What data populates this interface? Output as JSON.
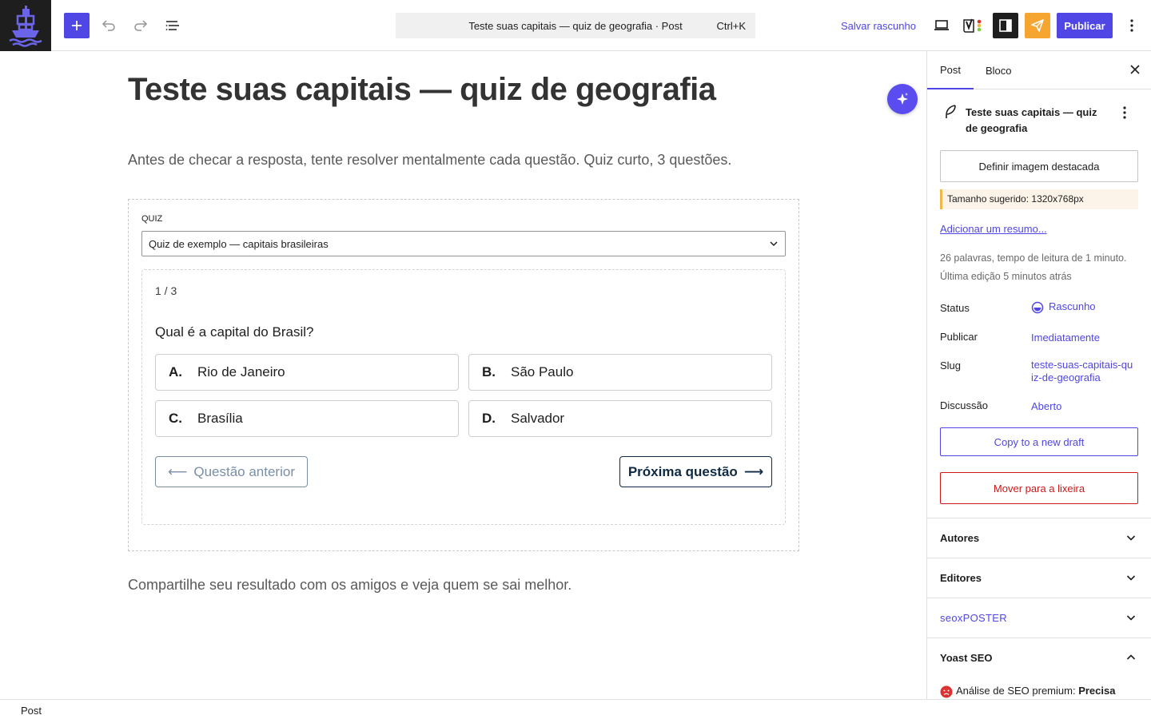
{
  "topbar": {
    "command_title": "Teste suas capitais — quiz de geografia · Post",
    "command_shortcut": "Ctrl+K",
    "save_draft": "Salvar rascunho",
    "publish": "Publicar",
    "accent_color": "#4f46e5"
  },
  "post": {
    "title": "Teste suas capitais — quiz de geografia",
    "intro": "Antes de checar a resposta, tente resolver mentalmente cada questão. Quiz curto, 3 questões.",
    "outro": "Compartilhe seu resultado com os amigos e veja quem se sai melhor."
  },
  "quiz": {
    "label": "QUIZ",
    "selected": "Quiz de exemplo — capitais brasileiras",
    "counter": "1 / 3",
    "question": "Qual é a capital do Brasil?",
    "options": [
      {
        "letter": "A.",
        "text": "Rio de Janeiro"
      },
      {
        "letter": "B.",
        "text": "São Paulo"
      },
      {
        "letter": "C.",
        "text": "Brasília"
      },
      {
        "letter": "D.",
        "text": "Salvador"
      }
    ],
    "prev_label": "Questão anterior",
    "next_label": "Próxima questão"
  },
  "sidebar": {
    "tabs": [
      "Post",
      "Bloco"
    ],
    "card_title": "Teste suas capitais — quiz de geografia",
    "featured_image": "Definir imagem destacada",
    "size_hint": "Tamanho sugerido: 1320x768px",
    "excerpt_link": "Adicionar um resumo...",
    "meta_line1": "26 palavras, tempo de leitura de 1 minuto.",
    "meta_line2": "Última edição 5 minutos atrás",
    "rows": [
      {
        "label": "Status",
        "value": "Rascunho"
      },
      {
        "label": "Publicar",
        "value": "Imediatamente"
      },
      {
        "label": "Slug",
        "value": "teste-suas-capitais-quiz-de-geografia"
      },
      {
        "label": "Discussão",
        "value": "Aberto"
      }
    ],
    "copy_draft": "Copy to a new draft",
    "trash": "Mover para a lixeira",
    "panels": [
      "Autores",
      "Editores",
      "seoxPOSTER",
      "Yoast SEO"
    ],
    "seo_prefix": "Análise de SEO premium:",
    "seo_status": "Precisa"
  },
  "footer": {
    "breadcrumb": "Post"
  }
}
